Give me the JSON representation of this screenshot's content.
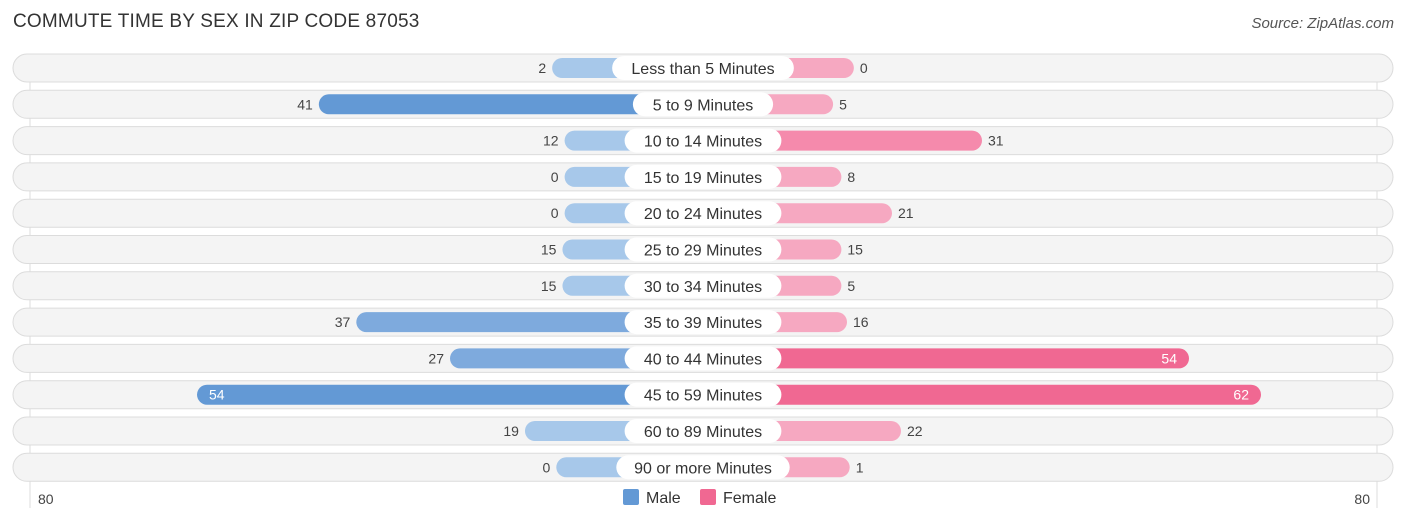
{
  "header": {
    "title": "COMMUTE TIME BY SEX IN ZIP CODE 87053",
    "source": "Source: ZipAtlas.com"
  },
  "chart_data": {
    "type": "bar",
    "orientation": "horizontal-diverging",
    "title": "COMMUTE TIME BY SEX IN ZIP CODE 87053",
    "categories": [
      "Less than 5 Minutes",
      "5 to 9 Minutes",
      "10 to 14 Minutes",
      "15 to 19 Minutes",
      "20 to 24 Minutes",
      "25 to 29 Minutes",
      "30 to 34 Minutes",
      "35 to 39 Minutes",
      "40 to 44 Minutes",
      "45 to 59 Minutes",
      "60 to 89 Minutes",
      "90 or more Minutes"
    ],
    "series": [
      {
        "name": "Male",
        "color": "#6399d5",
        "values": [
          2,
          41,
          12,
          0,
          0,
          15,
          15,
          37,
          27,
          54,
          19,
          0
        ]
      },
      {
        "name": "Female",
        "color": "#f06892",
        "values": [
          0,
          5,
          31,
          8,
          21,
          15,
          5,
          16,
          54,
          62,
          22,
          1
        ]
      }
    ],
    "axis": {
      "left_label": "80",
      "right_label": "80",
      "max": 80
    },
    "legend": {
      "position": "bottom-center",
      "items": [
        "Male",
        "Female"
      ]
    }
  }
}
